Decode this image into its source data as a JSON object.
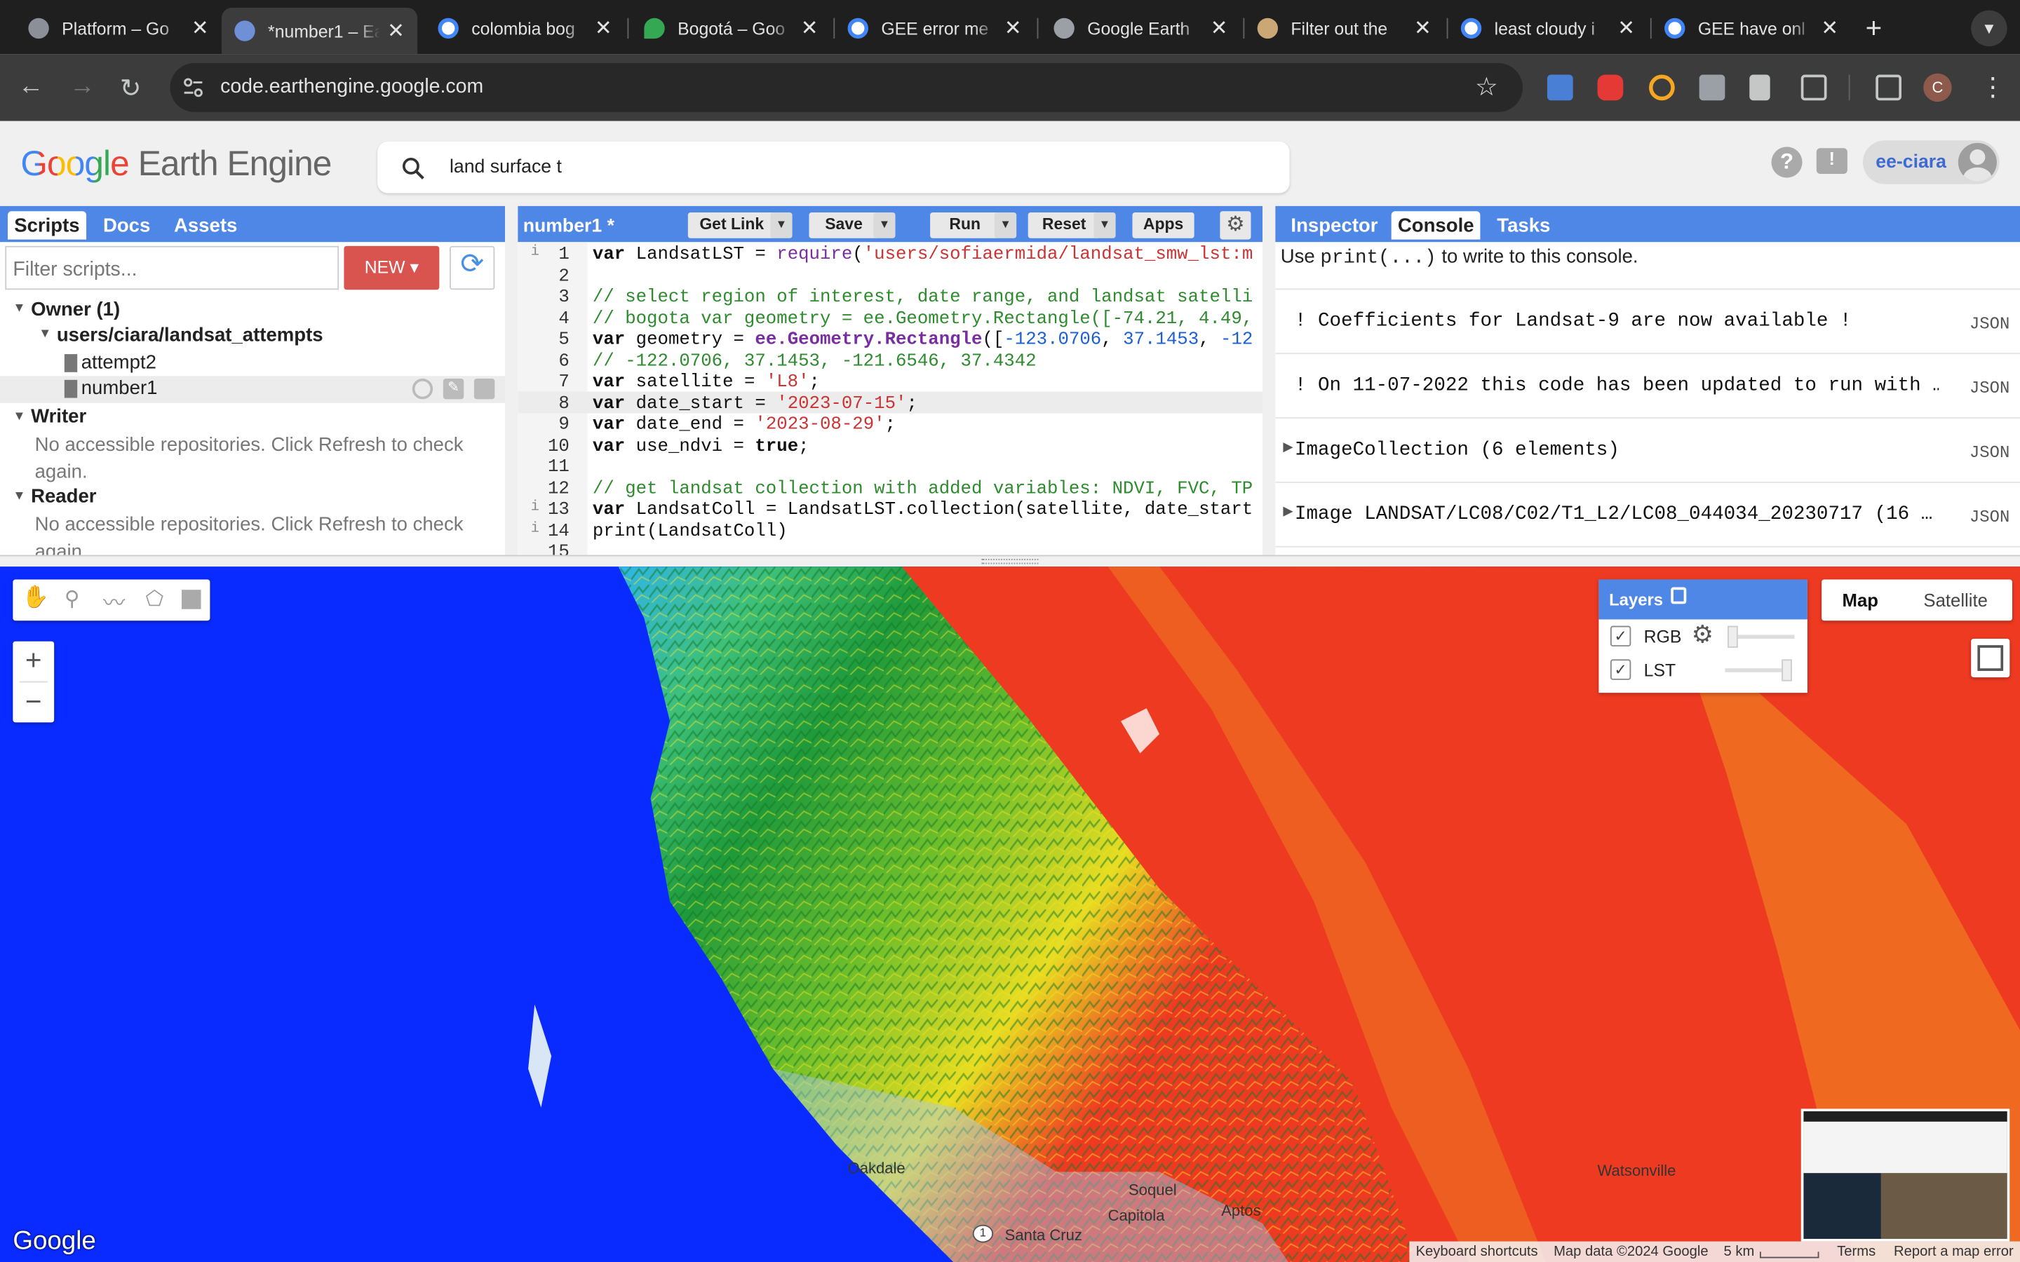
{
  "browser": {
    "tabs": [
      {
        "title": "Platform – Go"
      },
      {
        "title": "*number1 – Ea"
      },
      {
        "title": "colombia bog"
      },
      {
        "title": "Bogotá – Goo"
      },
      {
        "title": "GEE error me"
      },
      {
        "title": "Google Earth"
      },
      {
        "title": "Filter out the"
      },
      {
        "title": "least cloudy i"
      },
      {
        "title": "GEE have onl"
      }
    ],
    "url": "code.earthengine.google.com",
    "profile_initial": "C"
  },
  "gee": {
    "logo_google": "Google",
    "logo_product": "Earth Engine",
    "search_value": "land surface t",
    "username": "ee-ciara"
  },
  "left_panel": {
    "tabs": [
      "Scripts",
      "Docs",
      "Assets"
    ],
    "filter_placeholder": "Filter scripts...",
    "new_label": "NEW",
    "owner_label": "Owner (1)",
    "repo": "users/ciara/landsat_attempts",
    "files": [
      "attempt2",
      "number1"
    ],
    "writer_label": "Writer",
    "writer_msg": "No accessible repositories. Click Refresh to check again.",
    "reader_label": "Reader",
    "reader_msg": "No accessible repositories. Click Refresh to check again."
  },
  "editor": {
    "title": "number1 *",
    "buttons": {
      "get_link": "Get Link",
      "save": "Save",
      "run": "Run",
      "reset": "Reset",
      "apps": "Apps"
    }
  },
  "console": {
    "tabs": [
      "Inspector",
      "Console",
      "Tasks"
    ],
    "hint_pre": "Use ",
    "hint_code": "print(...)",
    "hint_post": " to write to this console.",
    "rows": [
      {
        "text": "! Coefficients for Landsat-9 are now available !",
        "badge": "JSON"
      },
      {
        "text": "! On 11-07-2022 this code has been updated to run with …",
        "badge": "JSON"
      },
      {
        "text": "ImageCollection (6 elements)",
        "badge": "JSON"
      },
      {
        "text": "Image LANDSAT/LC08/C02/T1_L2/LC08_044034_20230717 (16 …",
        "badge": "JSON"
      }
    ]
  },
  "map": {
    "layers_title": "Layers",
    "layers": [
      {
        "name": "RGB"
      },
      {
        "name": "LST"
      }
    ],
    "map_types": [
      "Map",
      "Satellite"
    ],
    "places": [
      "Oakdale",
      "Santa Cruz",
      "Watsonville",
      "Aptos",
      "Soquel",
      "Capitola"
    ],
    "footer": {
      "keyboard": "Keyboard shortcuts",
      "data": "Map data ©2024 Google",
      "scale": "5 km",
      "terms": "Terms",
      "report": "Report a map error"
    },
    "google_mark": "Google",
    "road_shield": "1"
  }
}
